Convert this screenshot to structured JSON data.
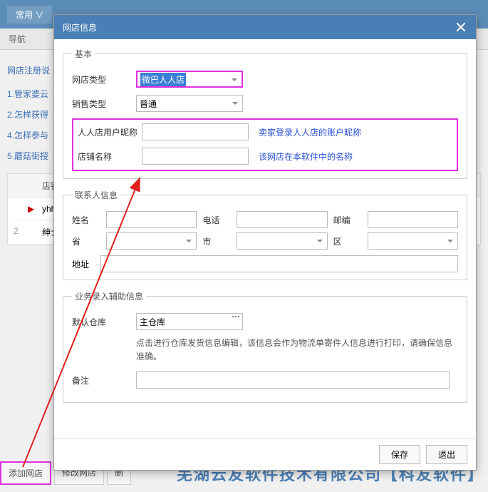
{
  "bg": {
    "top_tab": "常用",
    "nav": "导航",
    "reg_title": "网店注册说",
    "steps": [
      "1.管家婆云",
      "2.怎样获得",
      "4.怎样参与",
      "5.蘑菇街授"
    ],
    "table": {
      "header": "店铺",
      "rows": [
        {
          "num": "",
          "marker": "▶",
          "name": "yhh"
        },
        {
          "num": "2",
          "marker": "",
          "name": "绅士"
        }
      ]
    },
    "bottom_tabs": {
      "add": "添加网店",
      "edit": "修改网店",
      "del": "删"
    },
    "watermark": "芜湖云友软件技术有限公司【科友软件】"
  },
  "modal": {
    "title": "网店信息",
    "basic": {
      "legend": "基本",
      "shop_type_label": "网店类型",
      "shop_type_value": "微巴人人店",
      "sale_type_label": "销售类型",
      "sale_type_value": "普通",
      "nickname_label": "人人店用户昵称",
      "nickname_hint": "卖家登录人人店的账户昵称",
      "shopname_label": "店铺名称",
      "shopname_hint": "该网店在本软件中的名称"
    },
    "contact": {
      "legend": "联系人信息",
      "name": "姓名",
      "phone": "电话",
      "zip": "邮编",
      "province": "省",
      "city": "市",
      "district": "区",
      "address": "地址"
    },
    "aux": {
      "legend": "业务录入辅助信息",
      "warehouse_label": "默认仓库",
      "warehouse_value": "主仓库",
      "warehouse_note": "点击进行仓库发货信息编辑，该信息会作为物流单寄件人信息进行打印，请确保信息准确。",
      "remark_label": "备注"
    },
    "footer": {
      "save": "保存",
      "exit": "退出"
    }
  }
}
